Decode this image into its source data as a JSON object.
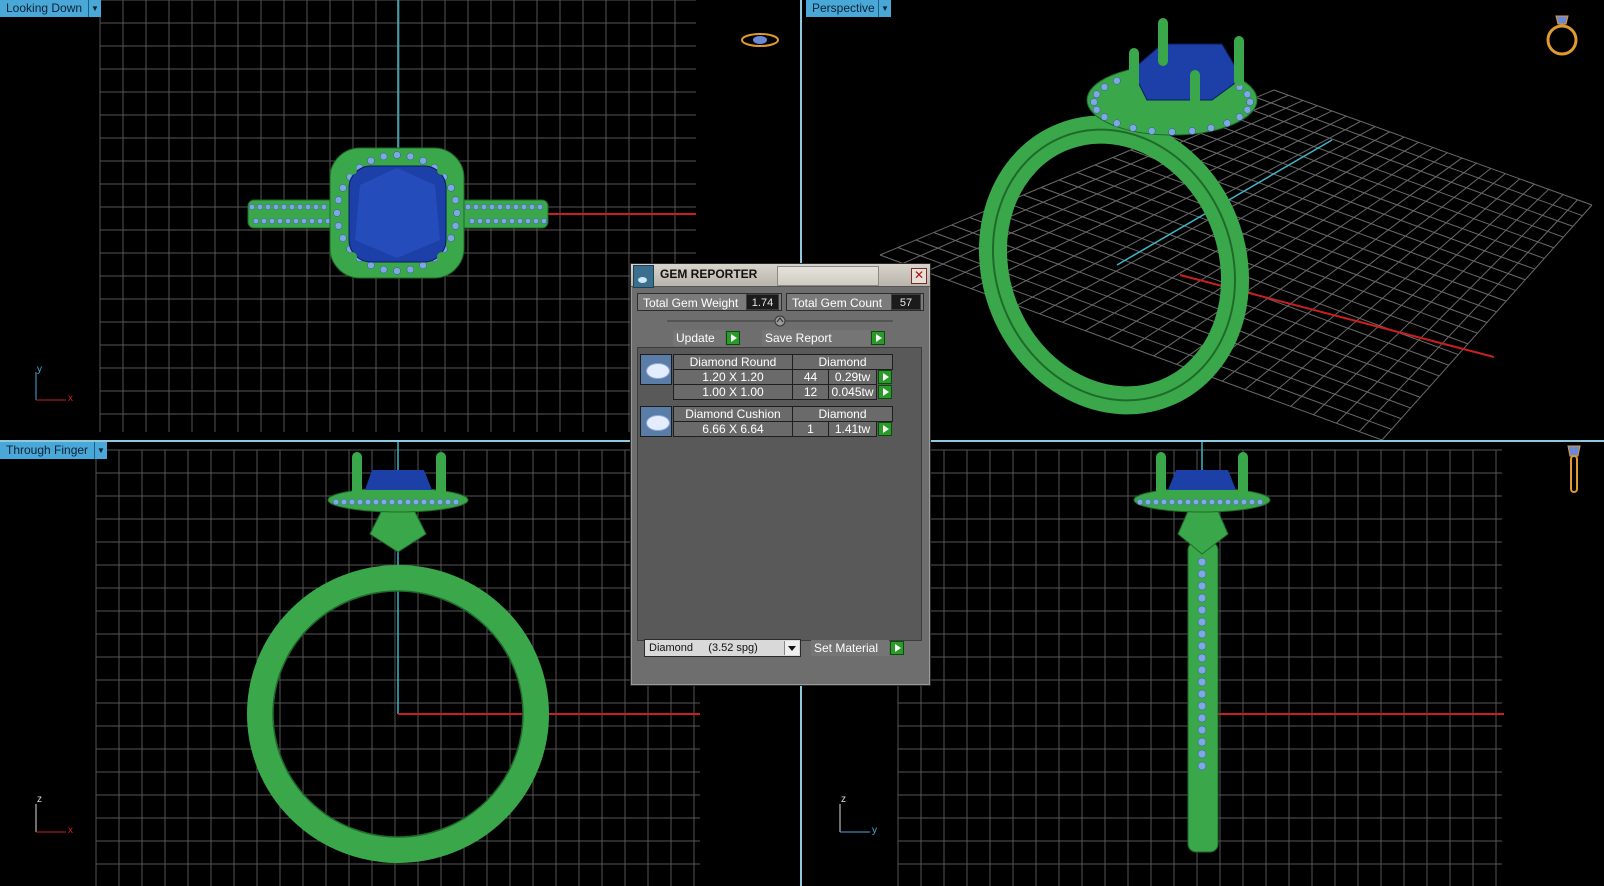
{
  "viewports": {
    "top_left": {
      "label": "Looking Down",
      "axis_v": "y",
      "axis_h": "x"
    },
    "top_right": {
      "label": "Perspective"
    },
    "bottom_left": {
      "label": "Through Finger",
      "axis_v": "z",
      "axis_h": "x"
    },
    "bottom_right": {
      "axis_v": "z",
      "axis_h": "y"
    }
  },
  "gem_reporter": {
    "title": "GEM REPORTER",
    "close_glyph": "✕",
    "total_weight_label": "Total Gem Weight",
    "total_weight_value": "1.74",
    "total_count_label": "Total Gem Count",
    "total_count_value": "57",
    "update_label": "Update",
    "save_report_label": "Save Report",
    "groups": [
      {
        "shape": "Diamond Round",
        "material": "Diamond",
        "rows": [
          {
            "size": "1.20 X 1.20",
            "count": "44",
            "weight": "0.29tw"
          },
          {
            "size": "1.00 X 1.00",
            "count": "12",
            "weight": "0.045tw"
          }
        ]
      },
      {
        "shape": "Diamond Cushion",
        "material": "Diamond",
        "rows": [
          {
            "size": "6.66 X 6.64",
            "count": "1",
            "weight": "1.41tw"
          }
        ]
      }
    ],
    "material_select": "Diamond     (3.52 spg)",
    "set_material_label": "Set Material"
  },
  "icons": [
    "dropdown-arrow-icon",
    "ring-top-view-icon",
    "ring-perspective-icon",
    "ring-side-view-icon",
    "gem-reporter-app-icon",
    "close-icon",
    "play-arrow-icon",
    "gem-round-thumb-icon",
    "gem-cushion-thumb-icon"
  ],
  "colors": {
    "viewport_label_bg": "#4aa8d8",
    "model_green": "#3aa84a",
    "center_stone_blue": "#1c3fa8",
    "accent_stone": "#7fa8e0",
    "grid_line": "#5a5a5a",
    "axis_red": "#c82020",
    "axis_cyan": "#3fb6c8",
    "button_green": "#2a9a2a"
  }
}
